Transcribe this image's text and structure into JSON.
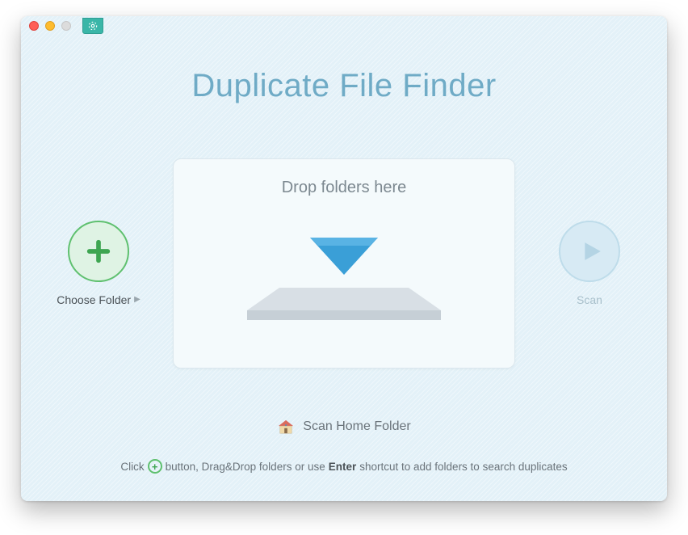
{
  "app": {
    "title": "Duplicate File Finder"
  },
  "leftAction": {
    "label": "Choose Folder",
    "chevron": "▶"
  },
  "rightAction": {
    "label": "Scan"
  },
  "dropzone": {
    "hint": "Drop folders here"
  },
  "homeFolder": {
    "label": "Scan Home Folder"
  },
  "bottomHint": {
    "part1": "Click",
    "part2": "button, Drag&Drop folders or use",
    "bold": "Enter",
    "part3": "shortcut to add folders to search duplicates"
  }
}
